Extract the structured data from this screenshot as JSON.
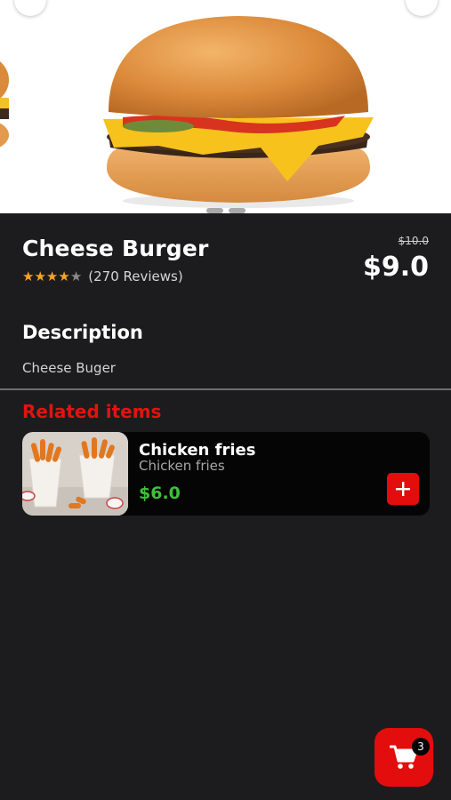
{
  "product": {
    "name": "Cheese Burger",
    "rating": 4,
    "rating_max": 5,
    "reviews_label": "(270 Reviews)",
    "old_price": "$10.0",
    "price": "$9.0"
  },
  "description": {
    "heading": "Description",
    "text": "Cheese Buger"
  },
  "related": {
    "heading": "Related items",
    "items": [
      {
        "name": "Chicken fries",
        "subtitle": "Chicken fries",
        "price": "$6.0"
      }
    ]
  },
  "cart": {
    "count": "3"
  },
  "colors": {
    "background": "#1c1c1e",
    "accent_red": "#e30d0d",
    "price_green": "#3fbf3a",
    "star": "#f7a325"
  },
  "icons": {
    "add": "plus-icon",
    "cart": "cart-icon",
    "star": "star-icon"
  }
}
